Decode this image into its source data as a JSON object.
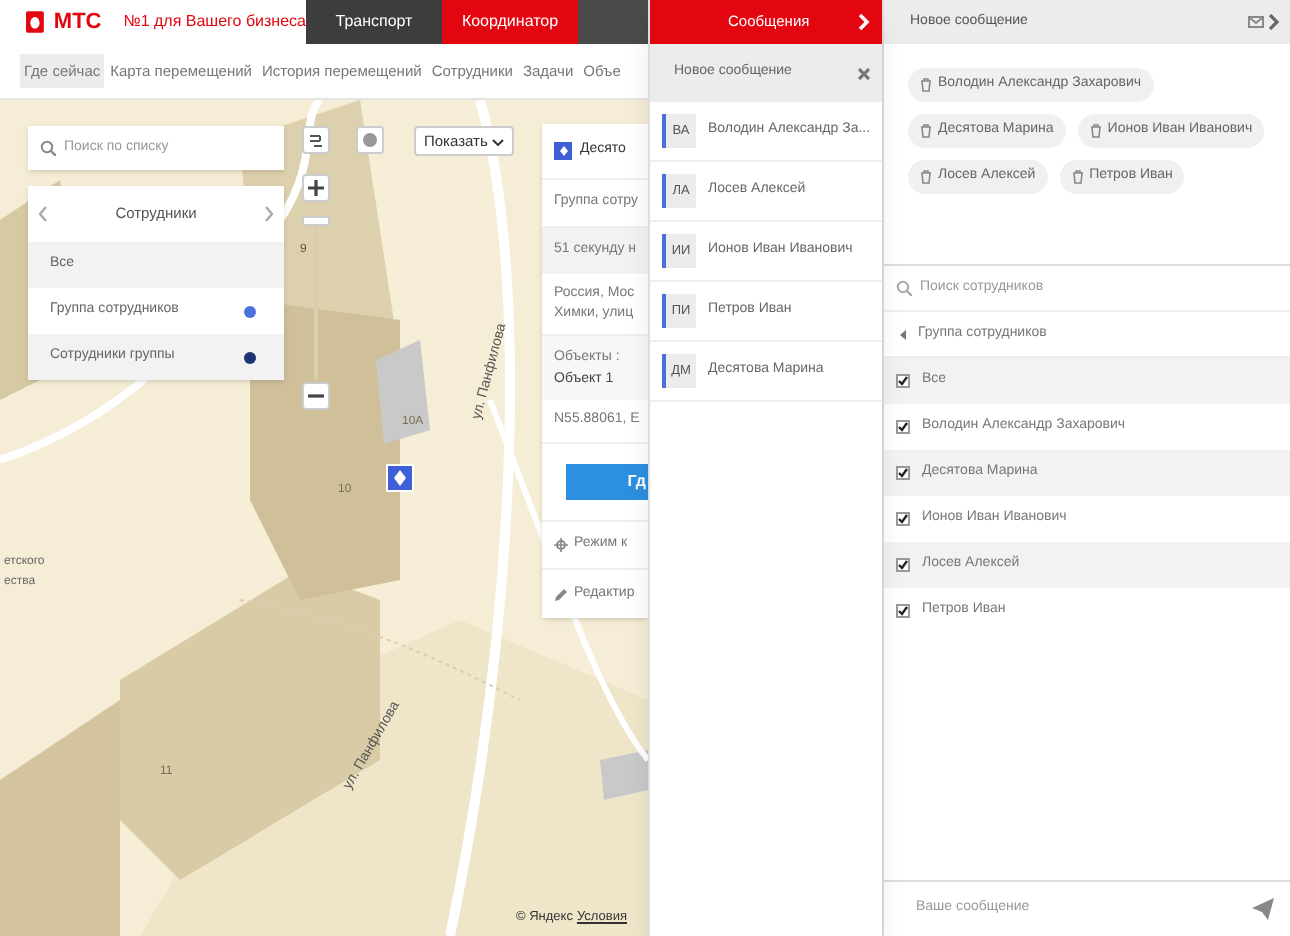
{
  "header": {
    "logo": "МТС",
    "slogan": "№1 для Вашего бизнеса",
    "tabs": [
      {
        "label": "Транспорт",
        "selected": false
      },
      {
        "label": "Координатор",
        "selected": true
      }
    ]
  },
  "nav": [
    {
      "label": "Где сейчас",
      "selected": true
    },
    {
      "label": "Карта перемещений",
      "selected": false
    },
    {
      "label": "История перемещений",
      "selected": false
    },
    {
      "label": "Сотрудники",
      "selected": false
    },
    {
      "label": "Задачи",
      "selected": false
    },
    {
      "label": "Объе",
      "selected": false
    }
  ],
  "map": {
    "search": {
      "placeholder": "Поиск по списку"
    },
    "list_panel": {
      "title": "Сотрудники",
      "items": [
        {
          "label": "Все"
        },
        {
          "label": "Группа сотрудников",
          "color": "#4a72dc"
        },
        {
          "label": "Сотрудники группы",
          "color": "#1f3370"
        }
      ]
    },
    "zoom_label": "9",
    "show_button": "Показать",
    "labels": [
      {
        "kind": "house",
        "text": "10А"
      },
      {
        "kind": "house",
        "text": "10"
      },
      {
        "kind": "house",
        "text": "11"
      },
      {
        "kind": "street",
        "text": "ул. Панфилова"
      },
      {
        "kind": "street",
        "text": "ул. Панфилова"
      },
      {
        "kind": "poi",
        "text": "етского"
      },
      {
        "kind": "poi",
        "text": "ества"
      }
    ],
    "copyright": "© Яндекс",
    "terms_link": "Условия",
    "info_card": {
      "title": "Десято",
      "group": "Группа сотру",
      "time": "51 секунду н",
      "address": [
        "Россия, Мос",
        "Химки, улиц"
      ],
      "objects_label": "Объекты :",
      "object": "Объект 1",
      "coords": "N55.88061, E",
      "button": "Гд",
      "actions": [
        {
          "kind": "track",
          "label": "Режим к"
        },
        {
          "kind": "edit",
          "label": "Редактир"
        }
      ]
    }
  },
  "messages": {
    "title": "Сообщения",
    "new_message": "Новое сообщение",
    "contacts": [
      {
        "initials": "ВА",
        "name": "Володин Александр За..."
      },
      {
        "initials": "ЛА",
        "name": "Лосев Алексей"
      },
      {
        "initials": "ИИ",
        "name": "Ионов Иван Иванович"
      },
      {
        "initials": "ПИ",
        "name": "Петров Иван"
      },
      {
        "initials": "ДМ",
        "name": "Десятова Марина"
      }
    ]
  },
  "compose": {
    "title": "Новое сообщение",
    "recipients": [
      "Володин Александр Захарович",
      "Десятова Марина",
      "Ионов Иван Иванович",
      "Лосев Алексей",
      "Петров Иван"
    ],
    "search": {
      "placeholder": "Поиск сотрудников"
    },
    "group": "Группа сотрудников",
    "options": [
      {
        "label": "Все",
        "checked": true
      },
      {
        "label": "Володин Александр Захарович",
        "checked": true
      },
      {
        "label": "Десятова Марина",
        "checked": true
      },
      {
        "label": "Ионов Иван Иванович",
        "checked": true
      },
      {
        "label": "Лосев Алексей",
        "checked": true
      },
      {
        "label": "Петров Иван",
        "checked": true
      }
    ],
    "message": {
      "placeholder": "Ваше сообщение"
    }
  }
}
